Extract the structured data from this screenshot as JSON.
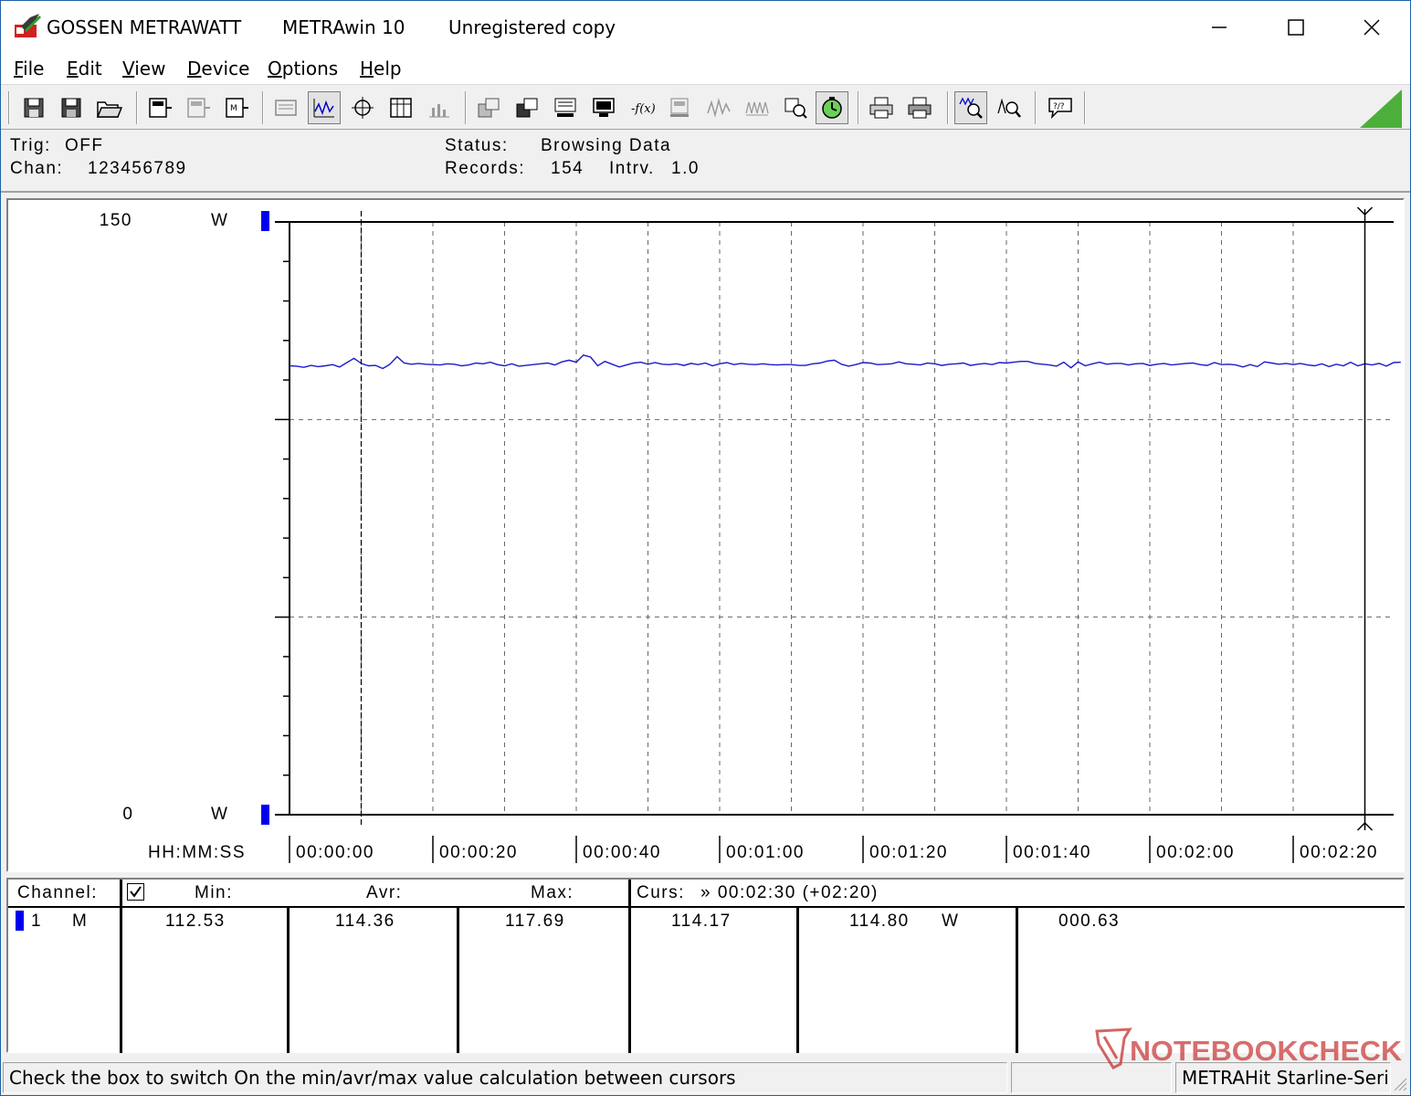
{
  "window": {
    "brand": "GOSSEN METRAWATT",
    "app_name": "METRAwin 10",
    "license": "Unregistered copy"
  },
  "menu": [
    "File",
    "Edit",
    "View",
    "Device",
    "Options",
    "Help"
  ],
  "info": {
    "trig_label": "Trig:",
    "trig_value": "OFF",
    "chan_label": "Chan:",
    "chan_value": "123456789",
    "status_label": "Status:",
    "status_value": "Browsing Data",
    "records_label": "Records:",
    "records_value": "154",
    "interval_label": "Intrv.",
    "interval_value": "1.0"
  },
  "chart_data": {
    "type": "line",
    "title": "",
    "xlabel": "HH:MM:SS",
    "ylabel": "W",
    "x_ticks": [
      "00:00:00",
      "00:00:20",
      "00:00:40",
      "00:01:00",
      "00:01:20",
      "00:01:40",
      "00:02:00",
      "00:02:20"
    ],
    "x_range_seconds": [
      0,
      154
    ],
    "ylim": [
      0,
      150
    ],
    "y_top_label": "150",
    "y_bottom_label": "0",
    "y_unit": "W",
    "grid": true,
    "series_color": "#1a1acc",
    "series": [
      {
        "values": [
          113.6,
          113.5,
          113.2,
          113.7,
          113.4,
          113.6,
          113.9,
          113.3,
          114.4,
          115.5,
          114.2,
          113.6,
          113.7,
          112.9,
          114.0,
          115.9,
          114.3,
          114.0,
          114.2,
          114.0,
          113.9,
          113.8,
          114.1,
          114.0,
          113.6,
          113.8,
          114.3,
          114.1,
          114.5,
          113.9,
          113.6,
          114.1,
          113.5,
          113.7,
          113.9,
          114.1,
          114.3,
          113.8,
          114.6,
          115.0,
          114.5,
          116.3,
          115.8,
          113.6,
          114.7,
          114.0,
          113.3,
          113.8,
          114.3,
          114.5,
          114.0,
          114.4,
          114.0,
          113.9,
          114.1,
          113.7,
          114.2,
          113.9,
          114.3,
          113.6,
          114.1,
          114.4,
          113.9,
          114.2,
          114.0,
          113.9,
          114.1,
          113.9,
          113.8,
          113.9,
          113.9,
          113.7,
          113.7,
          114.1,
          114.3,
          114.8,
          115.0,
          114.0,
          113.5,
          113.9,
          114.4,
          114.3,
          113.9,
          114.0,
          114.1,
          114.6,
          114.1,
          114.0,
          113.8,
          114.3,
          114.1,
          113.7,
          114.0,
          114.1,
          114.3,
          113.7,
          114.0,
          114.2,
          113.9,
          114.4,
          114.3,
          114.5,
          114.7,
          114.7,
          114.2,
          114.0,
          113.8,
          113.5,
          114.5,
          113.1,
          114.6,
          113.6,
          114.1,
          114.5,
          114.0,
          114.2,
          114.2,
          113.8,
          114.1,
          114.2,
          113.7,
          114.0,
          114.2,
          113.8,
          114.0,
          114.2,
          114.3,
          113.9,
          113.7,
          114.4,
          113.9,
          114.0,
          113.8,
          113.3,
          113.9,
          113.4,
          114.6,
          114.3,
          114.0,
          114.2,
          113.9,
          114.2,
          113.8,
          113.6,
          114.1,
          113.4,
          114.0,
          113.6,
          114.5,
          113.6,
          114.1,
          113.8,
          114.2,
          113.5,
          114.4,
          114.5
        ]
      }
    ]
  },
  "table": {
    "headers": {
      "channel": "Channel:",
      "min": "Min:",
      "avr": "Avr:",
      "max": "Max:",
      "curs": "Curs:",
      "curs_value": "» 00:02:30 (+02:20)"
    },
    "rows": [
      {
        "channel": "1",
        "mode": "M",
        "min": "112.53",
        "avr": "114.36",
        "max": "117.69",
        "curs1": "114.17",
        "curs2": "114.80",
        "unit": "W",
        "delta": "000.63"
      }
    ]
  },
  "status": {
    "hint": "Check the box to switch On the min/avr/max value calculation between cursors",
    "device": "METRAHit Starline-Seri"
  },
  "watermark": "NOTEBOOKCHECK",
  "colors": {
    "accent_blue": "#0000ee",
    "line_blue": "#1a1acc",
    "status_green": "#4caf3a"
  }
}
